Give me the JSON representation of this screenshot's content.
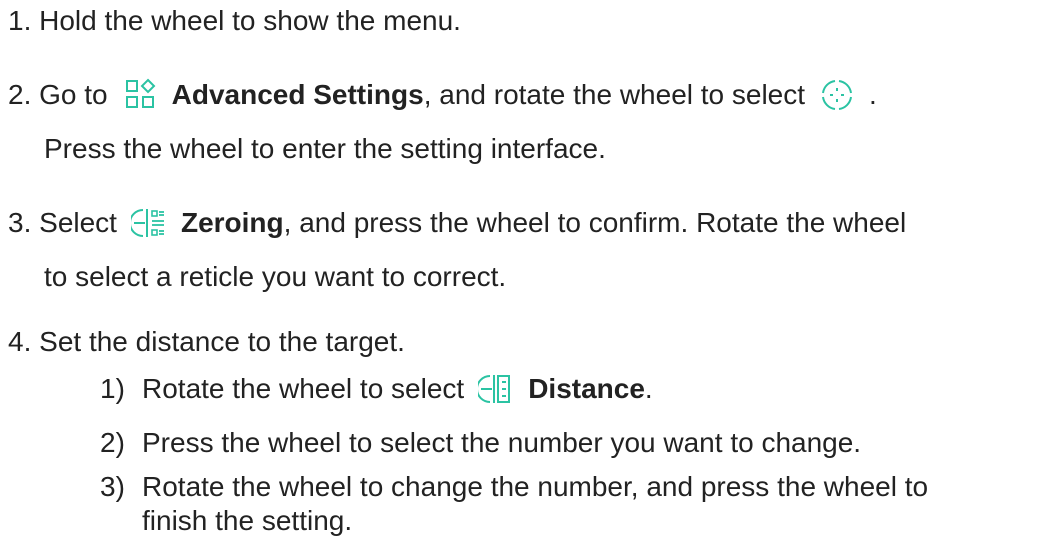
{
  "accent_color": "#2bc3a3",
  "steps": [
    {
      "number": "1.",
      "text": "Hold the wheel to show the menu."
    },
    {
      "number": "2.",
      "pre": "Go to",
      "icon1": "advanced-settings-icon",
      "bold": "Advanced Settings",
      "mid": ", and rotate the wheel to select",
      "icon2": "crosshair-icon",
      "end": ".",
      "line2": "Press the wheel to enter the setting interface."
    },
    {
      "number": "3.",
      "pre": "Select",
      "icon": "zeroing-icon",
      "bold": "Zeroing",
      "post": ", and press the wheel to confirm. Rotate the wheel",
      "line2": "to select a reticle you want to correct."
    },
    {
      "number": "4.",
      "text": "Set the distance to the target.",
      "substeps": [
        {
          "number": "1)",
          "pre": "Rotate the wheel to select",
          "icon": "distance-icon",
          "bold": "Distance",
          "end": "."
        },
        {
          "number": "2)",
          "text": "Press the wheel to select the number you want to change."
        },
        {
          "number": "3)",
          "text": "Rotate the wheel to change the number, and press the wheel to",
          "line2": "finish the setting."
        }
      ]
    }
  ]
}
